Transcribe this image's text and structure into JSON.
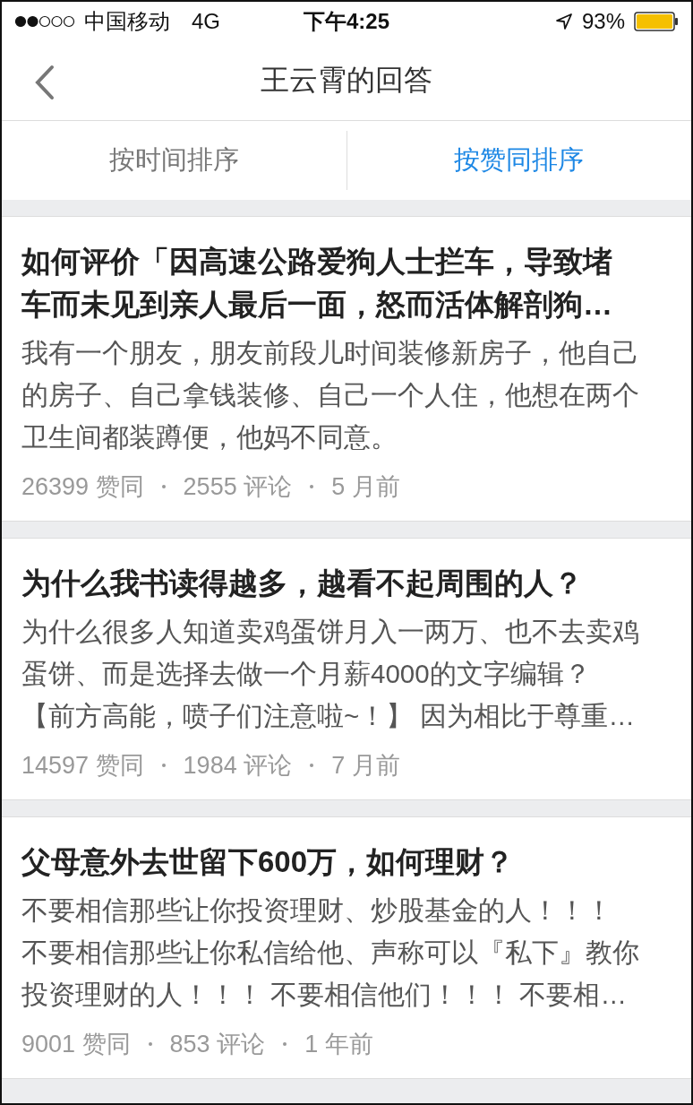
{
  "status_bar": {
    "carrier": "中国移动",
    "network": "4G",
    "time": "下午4:25",
    "battery": "93%"
  },
  "nav": {
    "title": "王云霄的回答"
  },
  "tabs": [
    {
      "label": "按时间排序",
      "selected": false
    },
    {
      "label": "按赞同排序",
      "selected": true
    }
  ],
  "answers": [
    {
      "title_lines": [
        "如何评价「因高速公路爱狗人士拦车，导致堵",
        "车而未见到亲人最后一面，怒而活体解剖狗…"
      ],
      "excerpt_lines": [
        "我有一个朋友，朋友前段儿时间装修新房子，他自己",
        "的房子、自己拿钱装修、自己一个人住，他想在两个",
        "卫生间都装蹲便，他妈不同意。"
      ],
      "votes": "26399 赞同",
      "comments": "2555 评论",
      "age": "5 月前"
    },
    {
      "title_lines": [
        "为什么我书读得越多，越看不起周围的人？"
      ],
      "excerpt_lines": [
        "为什么很多人知道卖鸡蛋饼月入一两万、也不去卖鸡",
        "蛋饼、而是选择去做一个月薪4000的文字编辑？",
        "【前方高能，喷子们注意啦~！】 因为相比于尊重…"
      ],
      "votes": "14597 赞同",
      "comments": "1984 评论",
      "age": "7 月前"
    },
    {
      "title_lines": [
        "父母意外去世留下600万，如何理财？"
      ],
      "excerpt_lines": [
        "不要相信那些让你投资理财、炒股基金的人！！！",
        "不要相信那些让你私信给他、声称可以『私下』教你",
        "投资理财的人！！！ 不要相信他们！！！ 不要相…"
      ],
      "votes": "9001 赞同",
      "comments": "853 评论",
      "age": "1 年前"
    }
  ]
}
